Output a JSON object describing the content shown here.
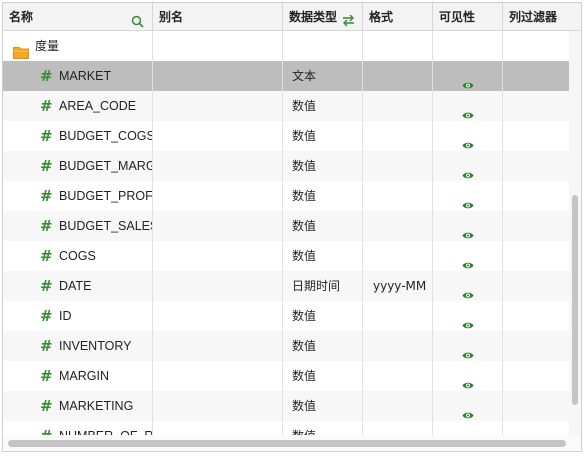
{
  "header": {
    "name_label": "名称",
    "alias_label": "别名",
    "datatype_label": "数据类型",
    "format_label": "格式",
    "visible_label": "可见性",
    "filter_label": "列过滤器"
  },
  "folder": {
    "label": "度量"
  },
  "rows": [
    {
      "name": "MARKET",
      "type": "文本",
      "format": "",
      "selected": true
    },
    {
      "name": "AREA_CODE",
      "type": "数值",
      "format": ""
    },
    {
      "name": "BUDGET_COGS",
      "type": "数值",
      "format": ""
    },
    {
      "name": "BUDGET_MARG",
      "type": "数值",
      "format": ""
    },
    {
      "name": "BUDGET_PROFI",
      "type": "数值",
      "format": ""
    },
    {
      "name": "BUDGET_SALES",
      "type": "数值",
      "format": ""
    },
    {
      "name": "COGS",
      "type": "数值",
      "format": ""
    },
    {
      "name": "DATE",
      "type": "日期时间",
      "format": "yyyy-MM"
    },
    {
      "name": "ID",
      "type": "数值",
      "format": ""
    },
    {
      "name": "INVENTORY",
      "type": "数值",
      "format": ""
    },
    {
      "name": "MARGIN",
      "type": "数值",
      "format": ""
    },
    {
      "name": "MARKETING",
      "type": "数值",
      "format": ""
    },
    {
      "name": "NUMBER_OF_RE",
      "type": "数值",
      "format": ""
    }
  ],
  "icons": {
    "search": "search-icon",
    "swap": "swap-icon",
    "folder": "folder-icon",
    "field": "measure-hash-icon",
    "visible": "eye-icon"
  },
  "colors": {
    "accent_green": "#3a8a3a",
    "eye_green": "#2e7d32",
    "folder_orange": "#f5a623",
    "selected_row": "#bdbdbd",
    "header_bg": "#f3f3f3"
  }
}
